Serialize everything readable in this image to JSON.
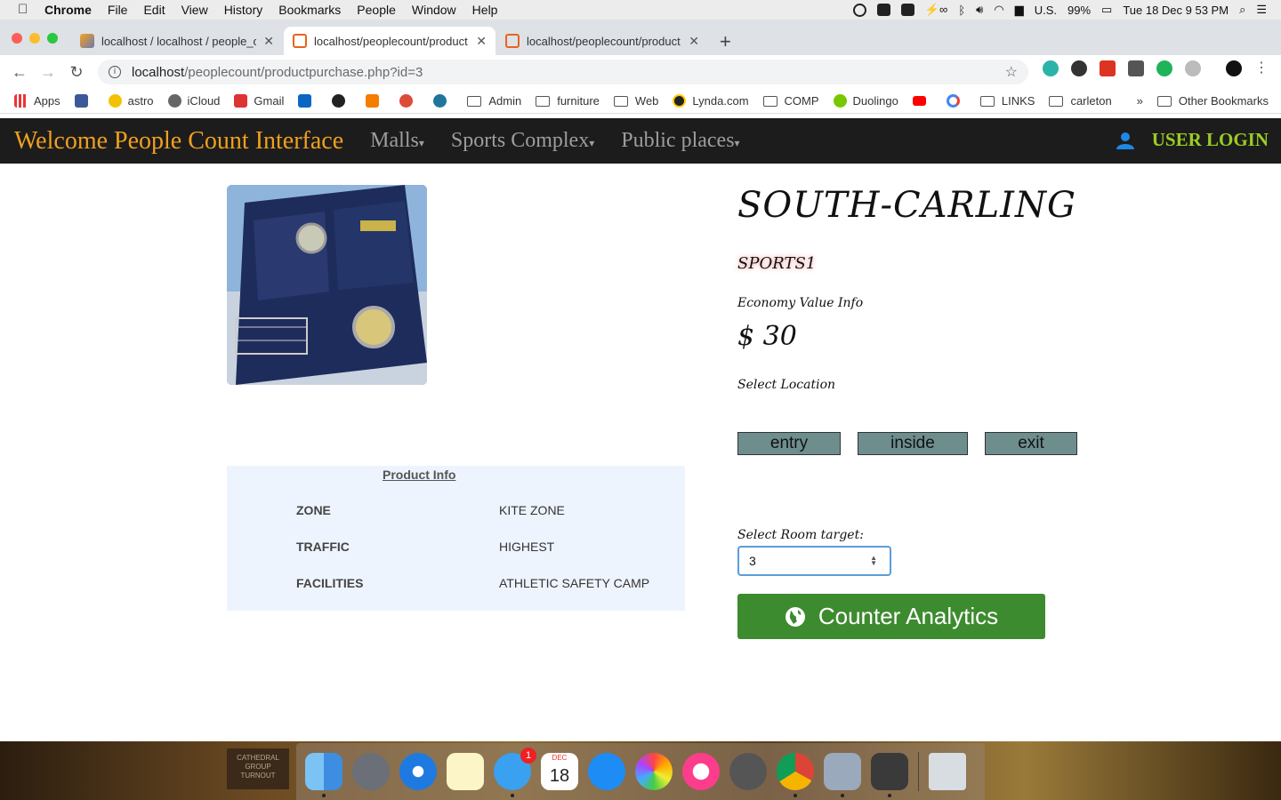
{
  "menubar": {
    "app": "Chrome",
    "items": [
      "File",
      "Edit",
      "View",
      "History",
      "Bookmarks",
      "People",
      "Window",
      "Help"
    ],
    "locale": "U.S.",
    "battery": "99%",
    "datetime": "Tue 18 Dec  9 53 PM"
  },
  "tabs": [
    {
      "title": "localhost / localhost / people_c"
    },
    {
      "title": "localhost/peoplecount/product"
    },
    {
      "title": "localhost/peoplecount/product"
    }
  ],
  "address": {
    "host": "localhost",
    "path": "/peoplecount/productpurchase.php?id=3"
  },
  "bookmarks": [
    {
      "label": "Apps",
      "icon": "apps-icon"
    },
    {
      "label": "",
      "icon": "facebook-icon"
    },
    {
      "label": "astro",
      "icon": "astro-icon"
    },
    {
      "label": "iCloud",
      "icon": "apple-icon"
    },
    {
      "label": "Gmail",
      "icon": "gmail-icon"
    },
    {
      "label": "",
      "icon": "linkedin-icon"
    },
    {
      "label": "",
      "icon": "tumblr-icon"
    },
    {
      "label": "",
      "icon": "blogger-icon"
    },
    {
      "label": "",
      "icon": "google-plus-icon"
    },
    {
      "label": "",
      "icon": "wordpress-icon"
    },
    {
      "label": "Admin",
      "icon": "folder-icon"
    },
    {
      "label": "furniture",
      "icon": "folder-icon"
    },
    {
      "label": "Web",
      "icon": "folder-icon"
    },
    {
      "label": "Lynda.com",
      "icon": "lynda-icon"
    },
    {
      "label": "COMP",
      "icon": "folder-icon"
    },
    {
      "label": "Duolingo",
      "icon": "duolingo-icon"
    },
    {
      "label": "",
      "icon": "youtube-icon"
    },
    {
      "label": "",
      "icon": "google-icon"
    },
    {
      "label": "LINKS",
      "icon": "folder-icon"
    },
    {
      "label": "carleton",
      "icon": "folder-icon"
    }
  ],
  "bookmarks_more": "»",
  "other_bookmarks": "Other Bookmarks",
  "nav": {
    "brand": "Welcome People Count Interface",
    "links": [
      "Malls",
      "Sports Complex",
      "Public places"
    ],
    "login": "USER LOGIN"
  },
  "product": {
    "title": "SOUTH-CARLING",
    "subtitle": "SPORTS1",
    "econ_label": "Economy Value Info",
    "price": "$ 30",
    "location_label": "Select Location",
    "locations": [
      "entry",
      "inside",
      "exit"
    ],
    "room_label": "Select Room target:",
    "room_value": "3",
    "analytics_button": "Counter Analytics"
  },
  "info": {
    "title": "Product Info",
    "rows": [
      {
        "key": "ZONE",
        "value": "KITE ZONE"
      },
      {
        "key": "TRAFFIC",
        "value": "HIGHEST"
      },
      {
        "key": "FACILITIES",
        "value": "ATHLETIC SAFETY CAMP"
      }
    ]
  },
  "dock": {
    "messages_badge": "1",
    "calendar_month": "DEC",
    "calendar_day": "18"
  },
  "desktop_sign": "CATHEDRAL GROUP TURNOUT",
  "colors": {
    "navbar_bg": "#1c1c1c",
    "brand": "#f0a020",
    "login": "#9bcc23",
    "analytics_bg": "#3d8b2f",
    "location_btn": "#6e8e8e",
    "info_bg": "#eef4fd"
  }
}
